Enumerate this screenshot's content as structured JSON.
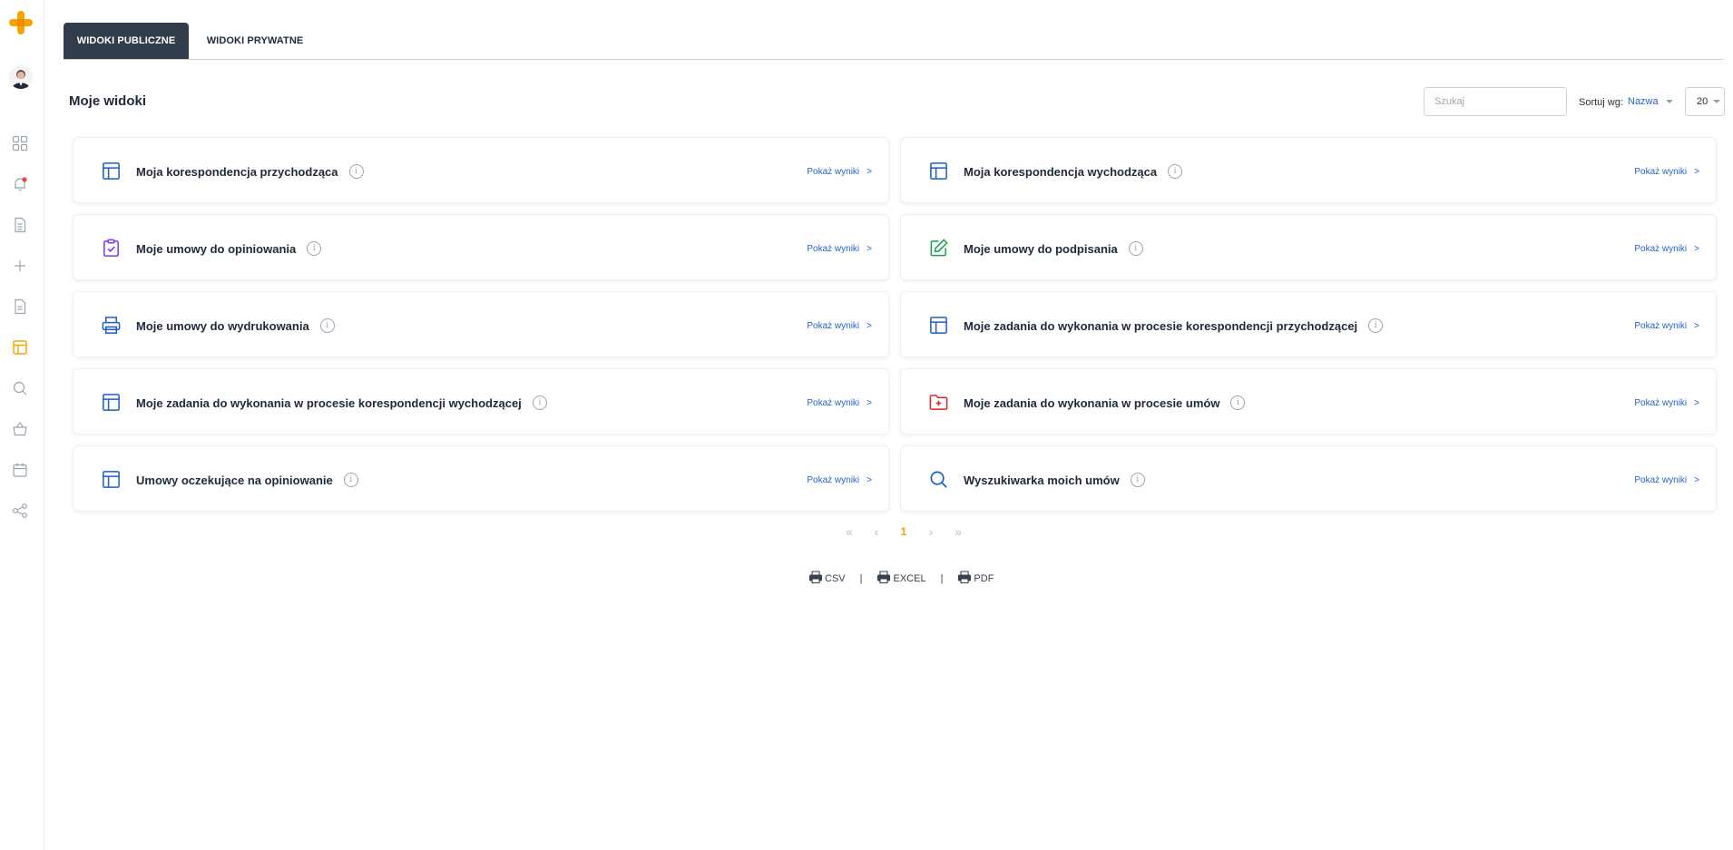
{
  "colors": {
    "accent": "#f5a300",
    "tab_active_bg": "#323d4b",
    "link": "#2563c9"
  },
  "sidebar": {
    "logo": "plus-logo-icon",
    "avatar": "user-avatar",
    "items": [
      {
        "icon": "dashboard-grid-icon"
      },
      {
        "icon": "bell-notification-icon",
        "badge": true
      },
      {
        "icon": "document-list-icon"
      },
      {
        "icon": "plus-icon"
      },
      {
        "icon": "document-icon"
      },
      {
        "icon": "table-layout-icon",
        "active": true
      },
      {
        "icon": "search-icon"
      },
      {
        "icon": "basket-icon"
      },
      {
        "icon": "calendar-icon"
      },
      {
        "icon": "share-icon"
      }
    ]
  },
  "tabs": [
    {
      "label": "WIDOKI PUBLICZNE",
      "active": true
    },
    {
      "label": "WIDOKI PRYWATNE",
      "active": false
    }
  ],
  "header": {
    "title": "Moje widoki",
    "search_placeholder": "Szukaj",
    "sort_label": "Sortuj wg:",
    "sort_value": "Nazwa",
    "page_size": "20"
  },
  "cards": [
    {
      "title": "Moja korespondencja przychodząca",
      "icon": "table-layout-icon",
      "link": "Pokaż wyniki",
      "arrow": ">"
    },
    {
      "title": "Moja korespondencja wychodząca",
      "icon": "table-layout-icon",
      "link": "Pokaż wyniki",
      "arrow": ">"
    },
    {
      "title": "Moje umowy do opiniowania",
      "icon": "clipboard-check-icon",
      "link": "Pokaż wyniki",
      "arrow": ">"
    },
    {
      "title": "Moje umowy do podpisania",
      "icon": "pen-edit-icon",
      "link": "Pokaż wyniki",
      "arrow": ">"
    },
    {
      "title": "Moje umowy do wydrukowania",
      "icon": "printer-icon",
      "link": "Pokaż wyniki",
      "arrow": ">"
    },
    {
      "title": "Moje zadania do wykonania w procesie korespondencji przychodzącej",
      "icon": "table-layout-icon",
      "link": "Pokaż wyniki",
      "arrow": ">"
    },
    {
      "title": "Moje zadania do wykonania w procesie korespondencji wychodzącej",
      "icon": "table-layout-icon",
      "link": "Pokaż wyniki",
      "arrow": ">"
    },
    {
      "title": "Moje zadania do wykonania w procesie umów",
      "icon": "folder-plus-icon",
      "link": "Pokaż wyniki",
      "arrow": ">"
    },
    {
      "title": "Umowy oczekujące na opiniowanie",
      "icon": "table-layout-icon",
      "link": "Pokaż wyniki",
      "arrow": ">"
    },
    {
      "title": "Wyszukiwarka moich umów",
      "icon": "search-icon",
      "link": "Pokaż wyniki",
      "arrow": ">"
    }
  ],
  "pagination": {
    "first": "«",
    "prev": "‹",
    "current": "1",
    "next": "›",
    "last": "»"
  },
  "exports": [
    {
      "label": "CSV",
      "icon": "printer-icon"
    },
    {
      "label": "EXCEL",
      "icon": "printer-icon"
    },
    {
      "label": "PDF",
      "icon": "printer-icon"
    }
  ],
  "export_separator": "|"
}
